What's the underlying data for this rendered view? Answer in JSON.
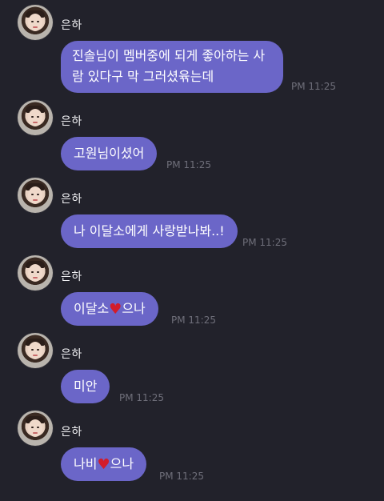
{
  "sender": "은하",
  "messages": [
    {
      "lines": [
        "진솔님이 멤버중에 되게 좋아하는 사",
        "람 있다구 막 그러셨윢는데"
      ],
      "time": "PM 11:25"
    },
    {
      "text": "고원님이셨어",
      "time": "PM 11:25"
    },
    {
      "text": "나 이달소에게 사랑받나봐..!",
      "time": "PM 11:25"
    },
    {
      "text_before": "이달소",
      "heart": "♥",
      "text_after": "으나",
      "time": "PM 11:25"
    },
    {
      "text": "미안",
      "time": "PM 11:25"
    },
    {
      "text_before": "나비",
      "heart": "♥",
      "text_after": "으나",
      "time": "PM 11:25"
    }
  ]
}
